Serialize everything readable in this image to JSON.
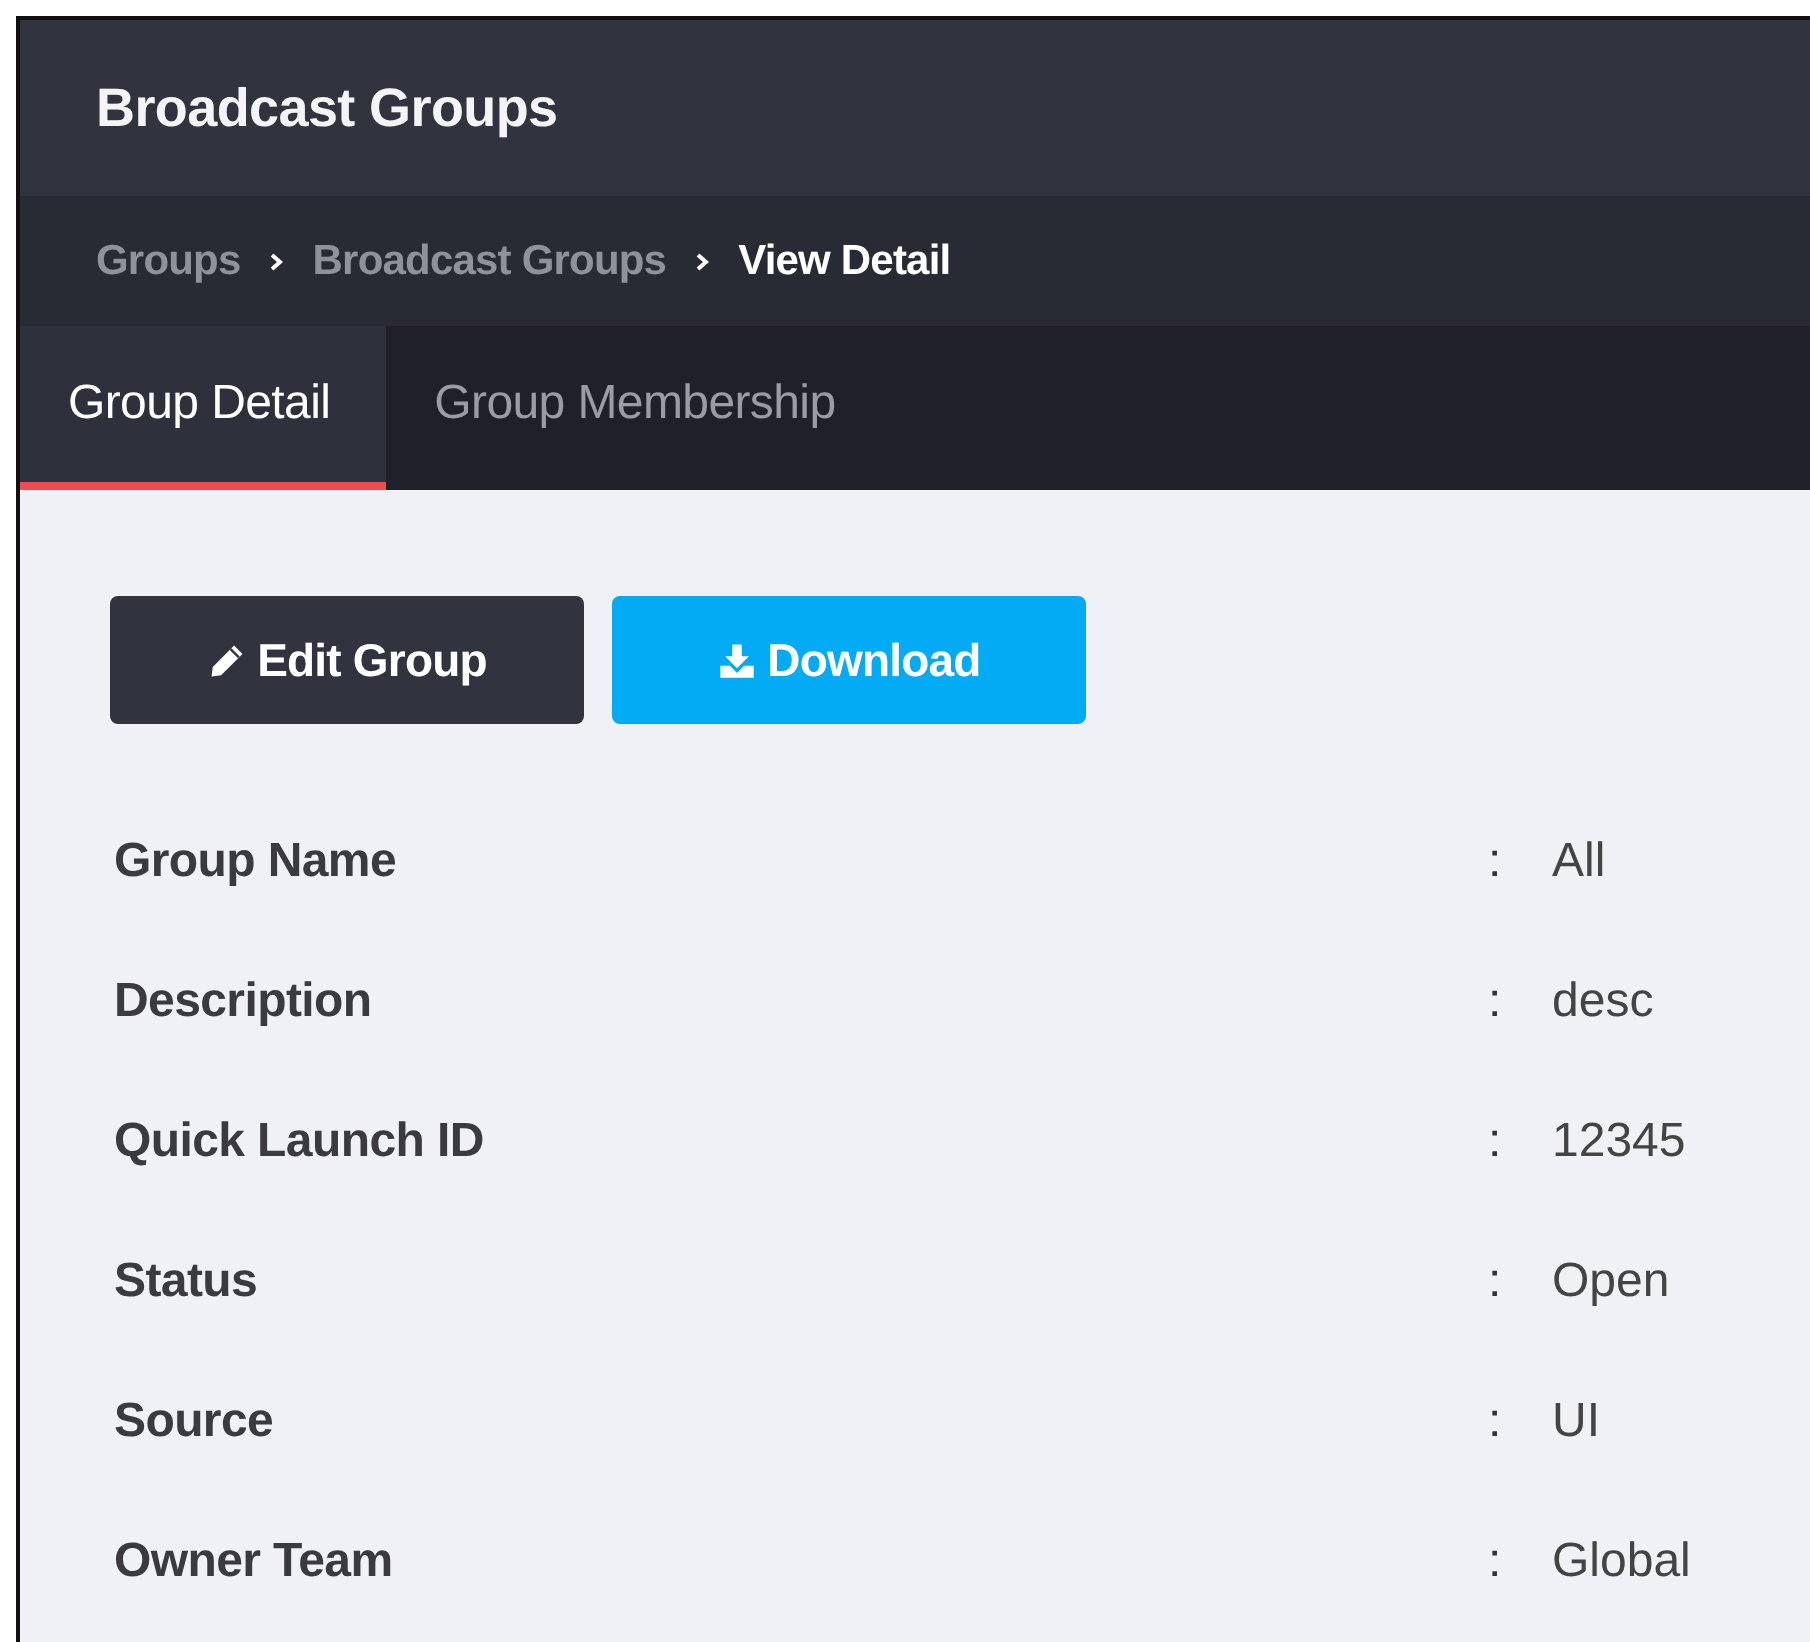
{
  "header": {
    "title": "Broadcast Groups"
  },
  "breadcrumb": [
    {
      "label": "Groups",
      "current": false
    },
    {
      "label": "Broadcast Groups",
      "current": false
    },
    {
      "label": "View Detail",
      "current": true
    }
  ],
  "tabs": [
    {
      "label": "Group Detail",
      "selected": true
    },
    {
      "label": "Group Membership",
      "selected": false
    }
  ],
  "actions": [
    {
      "label": "Edit Group",
      "kind": "edit"
    },
    {
      "label": "Download",
      "kind": "download"
    }
  ],
  "details": [
    {
      "label": "Group Name",
      "value": "All"
    },
    {
      "label": "Description",
      "value": "desc"
    },
    {
      "label": "Quick Launch ID",
      "value": "12345"
    },
    {
      "label": "Status",
      "value": "Open"
    },
    {
      "label": "Source",
      "value": "UI"
    },
    {
      "label": "Owner Team",
      "value": "Global"
    }
  ],
  "separator": ":"
}
